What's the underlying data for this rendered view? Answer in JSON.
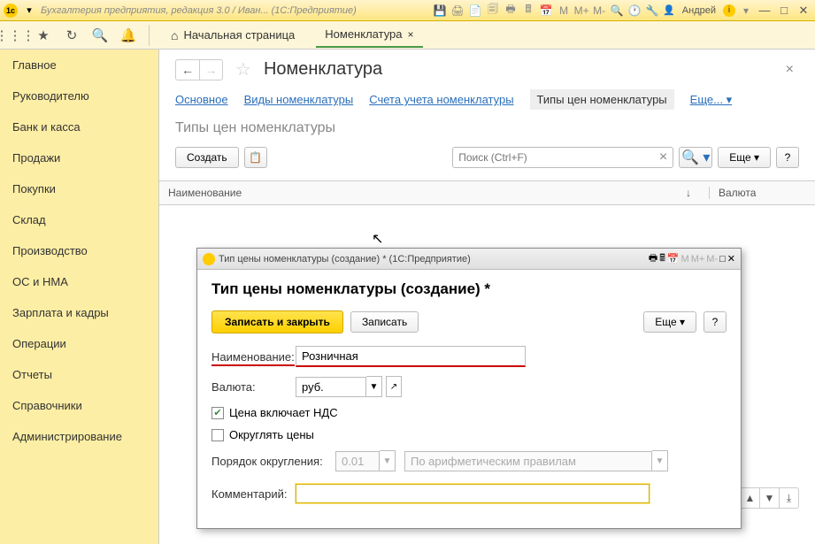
{
  "titlebar": {
    "title": "Бухгалтерия предприятия, редакция 3.0 / Иван...  (1С:Предприятие)",
    "user": "Андрей",
    "m1": "M",
    "m2": "M+",
    "m3": "M-"
  },
  "toolbar": {
    "home_tab": "Начальная страница",
    "active_tab": "Номенклатура"
  },
  "sidebar": {
    "items": [
      "Главное",
      "Руководителю",
      "Банк и касса",
      "Продажи",
      "Покупки",
      "Склад",
      "Производство",
      "ОС и НМА",
      "Зарплата и кадры",
      "Операции",
      "Отчеты",
      "Справочники",
      "Администрирование"
    ]
  },
  "page": {
    "title": "Номенклатура",
    "tabs": {
      "main": "Основное",
      "kinds": "Виды номенклатуры",
      "accounts": "Счета учета номенклатуры",
      "types": "Типы цен номенклатуры",
      "more": "Еще..."
    },
    "subtitle": "Типы цен номенклатуры",
    "create_btn": "Создать",
    "search_placeholder": "Поиск (Ctrl+F)",
    "more_btn": "Еще",
    "help_btn": "?",
    "table": {
      "col_name": "Наименование",
      "col_currency": "Валюта"
    }
  },
  "dialog": {
    "window_title": "Тип цены номенклатуры (создание) *  (1С:Предприятие)",
    "heading": "Тип цены номенклатуры (создание) *",
    "save_close": "Записать и закрыть",
    "save": "Записать",
    "more": "Еще",
    "help": "?",
    "name_label": "Наименование:",
    "name_value": "Розничная",
    "currency_label": "Валюта:",
    "currency_value": "руб.",
    "vat_label": "Цена включает НДС",
    "round_label": "Округлять цены",
    "round_order_label": "Порядок округления:",
    "round_order_value": "0.01",
    "round_method": "По арифметическим правилам",
    "comment_label": "Комментарий:",
    "comment_value": "",
    "m1": "M",
    "m2": "M+",
    "m3": "M-"
  }
}
